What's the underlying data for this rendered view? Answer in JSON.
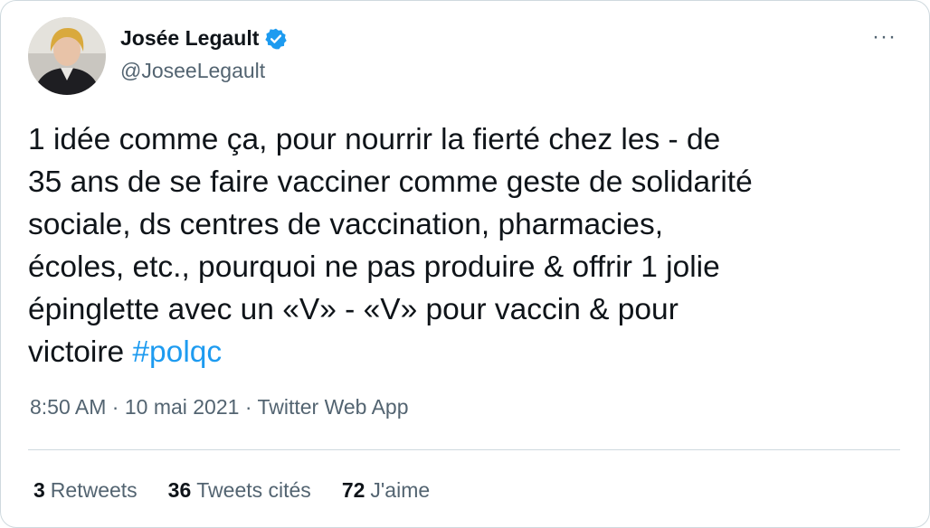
{
  "author": {
    "display_name": "Josée Legault",
    "handle": "@JoseeLegault",
    "verified": true
  },
  "tweet": {
    "text_main": "1 idée  comme  ça, pour nourrir la fierté chez les - de\n35 ans de se faire vacciner comme geste de solidarité\nsociale, ds centres de vaccination, pharmacies,\nécoles, etc., pourquoi ne pas produire & offrir 1  jolie\népinglette avec un «V» - «V» pour vaccin & pour\nvictoire  ",
    "hashtag": "#polqc"
  },
  "meta": {
    "time": "8:50 AM",
    "separator": " · ",
    "date": "10 mai 2021",
    "source": "Twitter Web App"
  },
  "stats": {
    "retweets_count": "3",
    "retweets_label": "Retweets",
    "quotes_count": "36",
    "quotes_label": "Tweets cités",
    "likes_count": "72",
    "likes_label": "J'aime"
  },
  "colors": {
    "accent": "#1d9bf0",
    "text": "#0f1419",
    "secondary": "#536471",
    "border": "#cfd9de"
  }
}
